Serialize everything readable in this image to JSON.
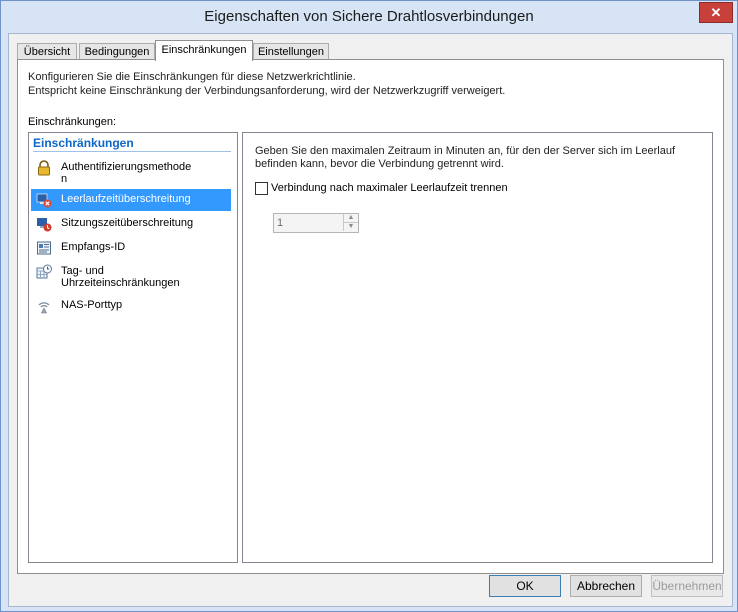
{
  "window": {
    "title": "Eigenschaften von Sichere Drahtlosverbindungen",
    "close_label": "✕"
  },
  "tabs": [
    {
      "label": "Übersicht",
      "active": false
    },
    {
      "label": "Bedingungen",
      "active": false
    },
    {
      "label": "Einschränkungen",
      "active": true
    },
    {
      "label": "Einstellungen",
      "active": false
    }
  ],
  "page": {
    "description_line1": "Konfigurieren Sie die Einschränkungen für diese Netzwerkrichtlinie.",
    "description_line2": "Entspricht keine Einschränkung der Verbindungsanforderung, wird der Netzwerkzugriff verweigert.",
    "group_label": "Einschränkungen:"
  },
  "constraints": {
    "header": "Einschränkungen",
    "items": [
      {
        "label1": "Authentifizierungsmethode",
        "label2": "n",
        "icon": "padlock-icon"
      },
      {
        "label1": "Leerlaufzeitüberschreitung",
        "label2": "",
        "icon": "idle-timeout-icon",
        "selected": true
      },
      {
        "label1": "Sitzungszeitüberschreitung",
        "label2": "",
        "icon": "session-timeout-icon"
      },
      {
        "label1": "Empfangs-ID",
        "label2": "",
        "icon": "calling-station-icon"
      },
      {
        "label1": "Tag- und",
        "label2": "Uhrzeiteinschränkungen",
        "icon": "calendar-clock-icon"
      },
      {
        "label1": "NAS-Porttyp",
        "label2": "",
        "icon": "port-type-icon"
      }
    ]
  },
  "detail": {
    "description_line1": "Geben Sie den maximalen Zeitraum in Minuten an, für den der Server sich im Leerlauf",
    "description_line2": "befinden kann, bevor die Verbindung getrennt wird.",
    "checkbox_label": "Verbindung nach maximaler Leerlaufzeit trennen",
    "checkbox_checked": false,
    "minutes_value": "1"
  },
  "buttons": {
    "ok": "OK",
    "cancel": "Abbrechen",
    "apply": "Übernehmen"
  }
}
